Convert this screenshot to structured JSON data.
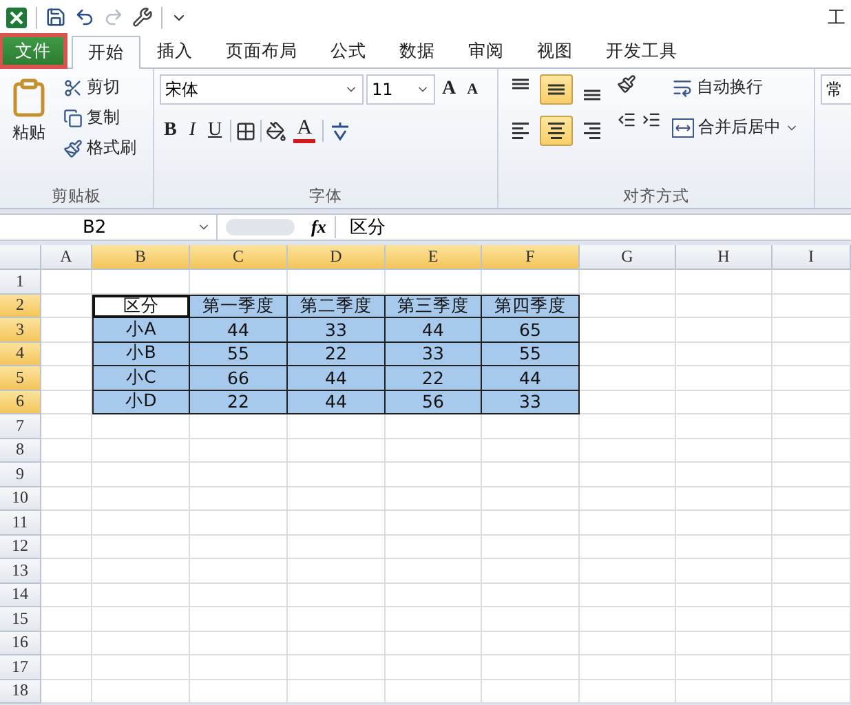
{
  "title_bar": {
    "title": "工"
  },
  "tabs": [
    {
      "label": "文件",
      "kind": "file",
      "selected": false,
      "highlighted": true
    },
    {
      "label": "开始",
      "kind": "tab",
      "selected": true,
      "highlighted": false
    },
    {
      "label": "插入",
      "kind": "tab",
      "selected": false,
      "highlighted": false
    },
    {
      "label": "页面布局",
      "kind": "tab",
      "selected": false,
      "highlighted": false
    },
    {
      "label": "公式",
      "kind": "tab",
      "selected": false,
      "highlighted": false
    },
    {
      "label": "数据",
      "kind": "tab",
      "selected": false,
      "highlighted": false
    },
    {
      "label": "审阅",
      "kind": "tab",
      "selected": false,
      "highlighted": false
    },
    {
      "label": "视图",
      "kind": "tab",
      "selected": false,
      "highlighted": false
    },
    {
      "label": "开发工具",
      "kind": "tab",
      "selected": false,
      "highlighted": false
    }
  ],
  "ribbon": {
    "clipboard": {
      "label": "剪贴板",
      "paste": "粘贴",
      "actions": [
        {
          "label": "剪切",
          "kind": "cut"
        },
        {
          "label": "复制",
          "kind": "copy"
        },
        {
          "label": "格式刷",
          "kind": "brush"
        }
      ]
    },
    "font": {
      "label": "字体",
      "font_name": "宋体",
      "font_size": "11",
      "grow": "A",
      "shrink": "A",
      "styles": [
        {
          "label": "B",
          "kind": "bold"
        },
        {
          "label": "I",
          "kind": "italic"
        },
        {
          "label": "U",
          "kind": "underline"
        }
      ],
      "font_color": "A"
    },
    "alignment": {
      "label": "对齐方式",
      "vertical": [
        {
          "kind": "top",
          "selected": false
        },
        {
          "kind": "middle",
          "selected": true
        },
        {
          "kind": "bottom",
          "selected": false
        }
      ],
      "horizontal": [
        {
          "kind": "left",
          "selected": false
        },
        {
          "kind": "center",
          "selected": true
        },
        {
          "kind": "right",
          "selected": false
        }
      ],
      "wrap": "自动换行",
      "merge": "合并后居中"
    },
    "number": {
      "format": "常"
    }
  },
  "formula_bar": {
    "name_box": "B2",
    "function_label": "fx",
    "content": "区分"
  },
  "columns": [
    {
      "label": "A",
      "selected": false
    },
    {
      "label": "B",
      "selected": true
    },
    {
      "label": "C",
      "selected": true
    },
    {
      "label": "D",
      "selected": true
    },
    {
      "label": "E",
      "selected": true
    },
    {
      "label": "F",
      "selected": true
    },
    {
      "label": "G",
      "selected": false
    },
    {
      "label": "H",
      "selected": false
    },
    {
      "label": "I",
      "selected": false
    }
  ],
  "rows": [
    {
      "label": "1",
      "selected": false
    },
    {
      "label": "2",
      "selected": true
    },
    {
      "label": "3",
      "selected": true
    },
    {
      "label": "4",
      "selected": true
    },
    {
      "label": "5",
      "selected": true
    },
    {
      "label": "6",
      "selected": true
    },
    {
      "label": "7",
      "selected": false
    },
    {
      "label": "8",
      "selected": false
    },
    {
      "label": "9",
      "selected": false
    },
    {
      "label": "10",
      "selected": false
    },
    {
      "label": "11",
      "selected": false
    },
    {
      "label": "12",
      "selected": false
    },
    {
      "label": "13",
      "selected": false
    },
    {
      "label": "14",
      "selected": false
    },
    {
      "label": "15",
      "selected": false
    },
    {
      "label": "16",
      "selected": false
    },
    {
      "label": "17",
      "selected": false
    },
    {
      "label": "18",
      "selected": false
    }
  ],
  "table": {
    "rows": [
      [
        {
          "text": "区分",
          "selected": true,
          "active": true
        },
        {
          "text": "第一季度",
          "selected": true,
          "active": false
        },
        {
          "text": "第二季度",
          "selected": true,
          "active": false
        },
        {
          "text": "第三季度",
          "selected": true,
          "active": false
        },
        {
          "text": "第四季度",
          "selected": true,
          "active": false
        }
      ],
      [
        {
          "text": "小A",
          "selected": true,
          "active": false
        },
        {
          "text": "44",
          "selected": true,
          "active": false
        },
        {
          "text": "33",
          "selected": true,
          "active": false
        },
        {
          "text": "44",
          "selected": true,
          "active": false
        },
        {
          "text": "65",
          "selected": true,
          "active": false
        }
      ],
      [
        {
          "text": "小B",
          "selected": true,
          "active": false
        },
        {
          "text": "55",
          "selected": true,
          "active": false
        },
        {
          "text": "22",
          "selected": true,
          "active": false
        },
        {
          "text": "33",
          "selected": true,
          "active": false
        },
        {
          "text": "55",
          "selected": true,
          "active": false
        }
      ],
      [
        {
          "text": "小C",
          "selected": true,
          "active": false
        },
        {
          "text": "66",
          "selected": true,
          "active": false
        },
        {
          "text": "44",
          "selected": true,
          "active": false
        },
        {
          "text": "22",
          "selected": true,
          "active": false
        },
        {
          "text": "44",
          "selected": true,
          "active": false
        }
      ],
      [
        {
          "text": "小D",
          "selected": true,
          "active": false
        },
        {
          "text": "22",
          "selected": true,
          "active": false
        },
        {
          "text": "44",
          "selected": true,
          "active": false
        },
        {
          "text": "56",
          "selected": true,
          "active": false
        },
        {
          "text": "33",
          "selected": true,
          "active": false
        }
      ]
    ]
  }
}
